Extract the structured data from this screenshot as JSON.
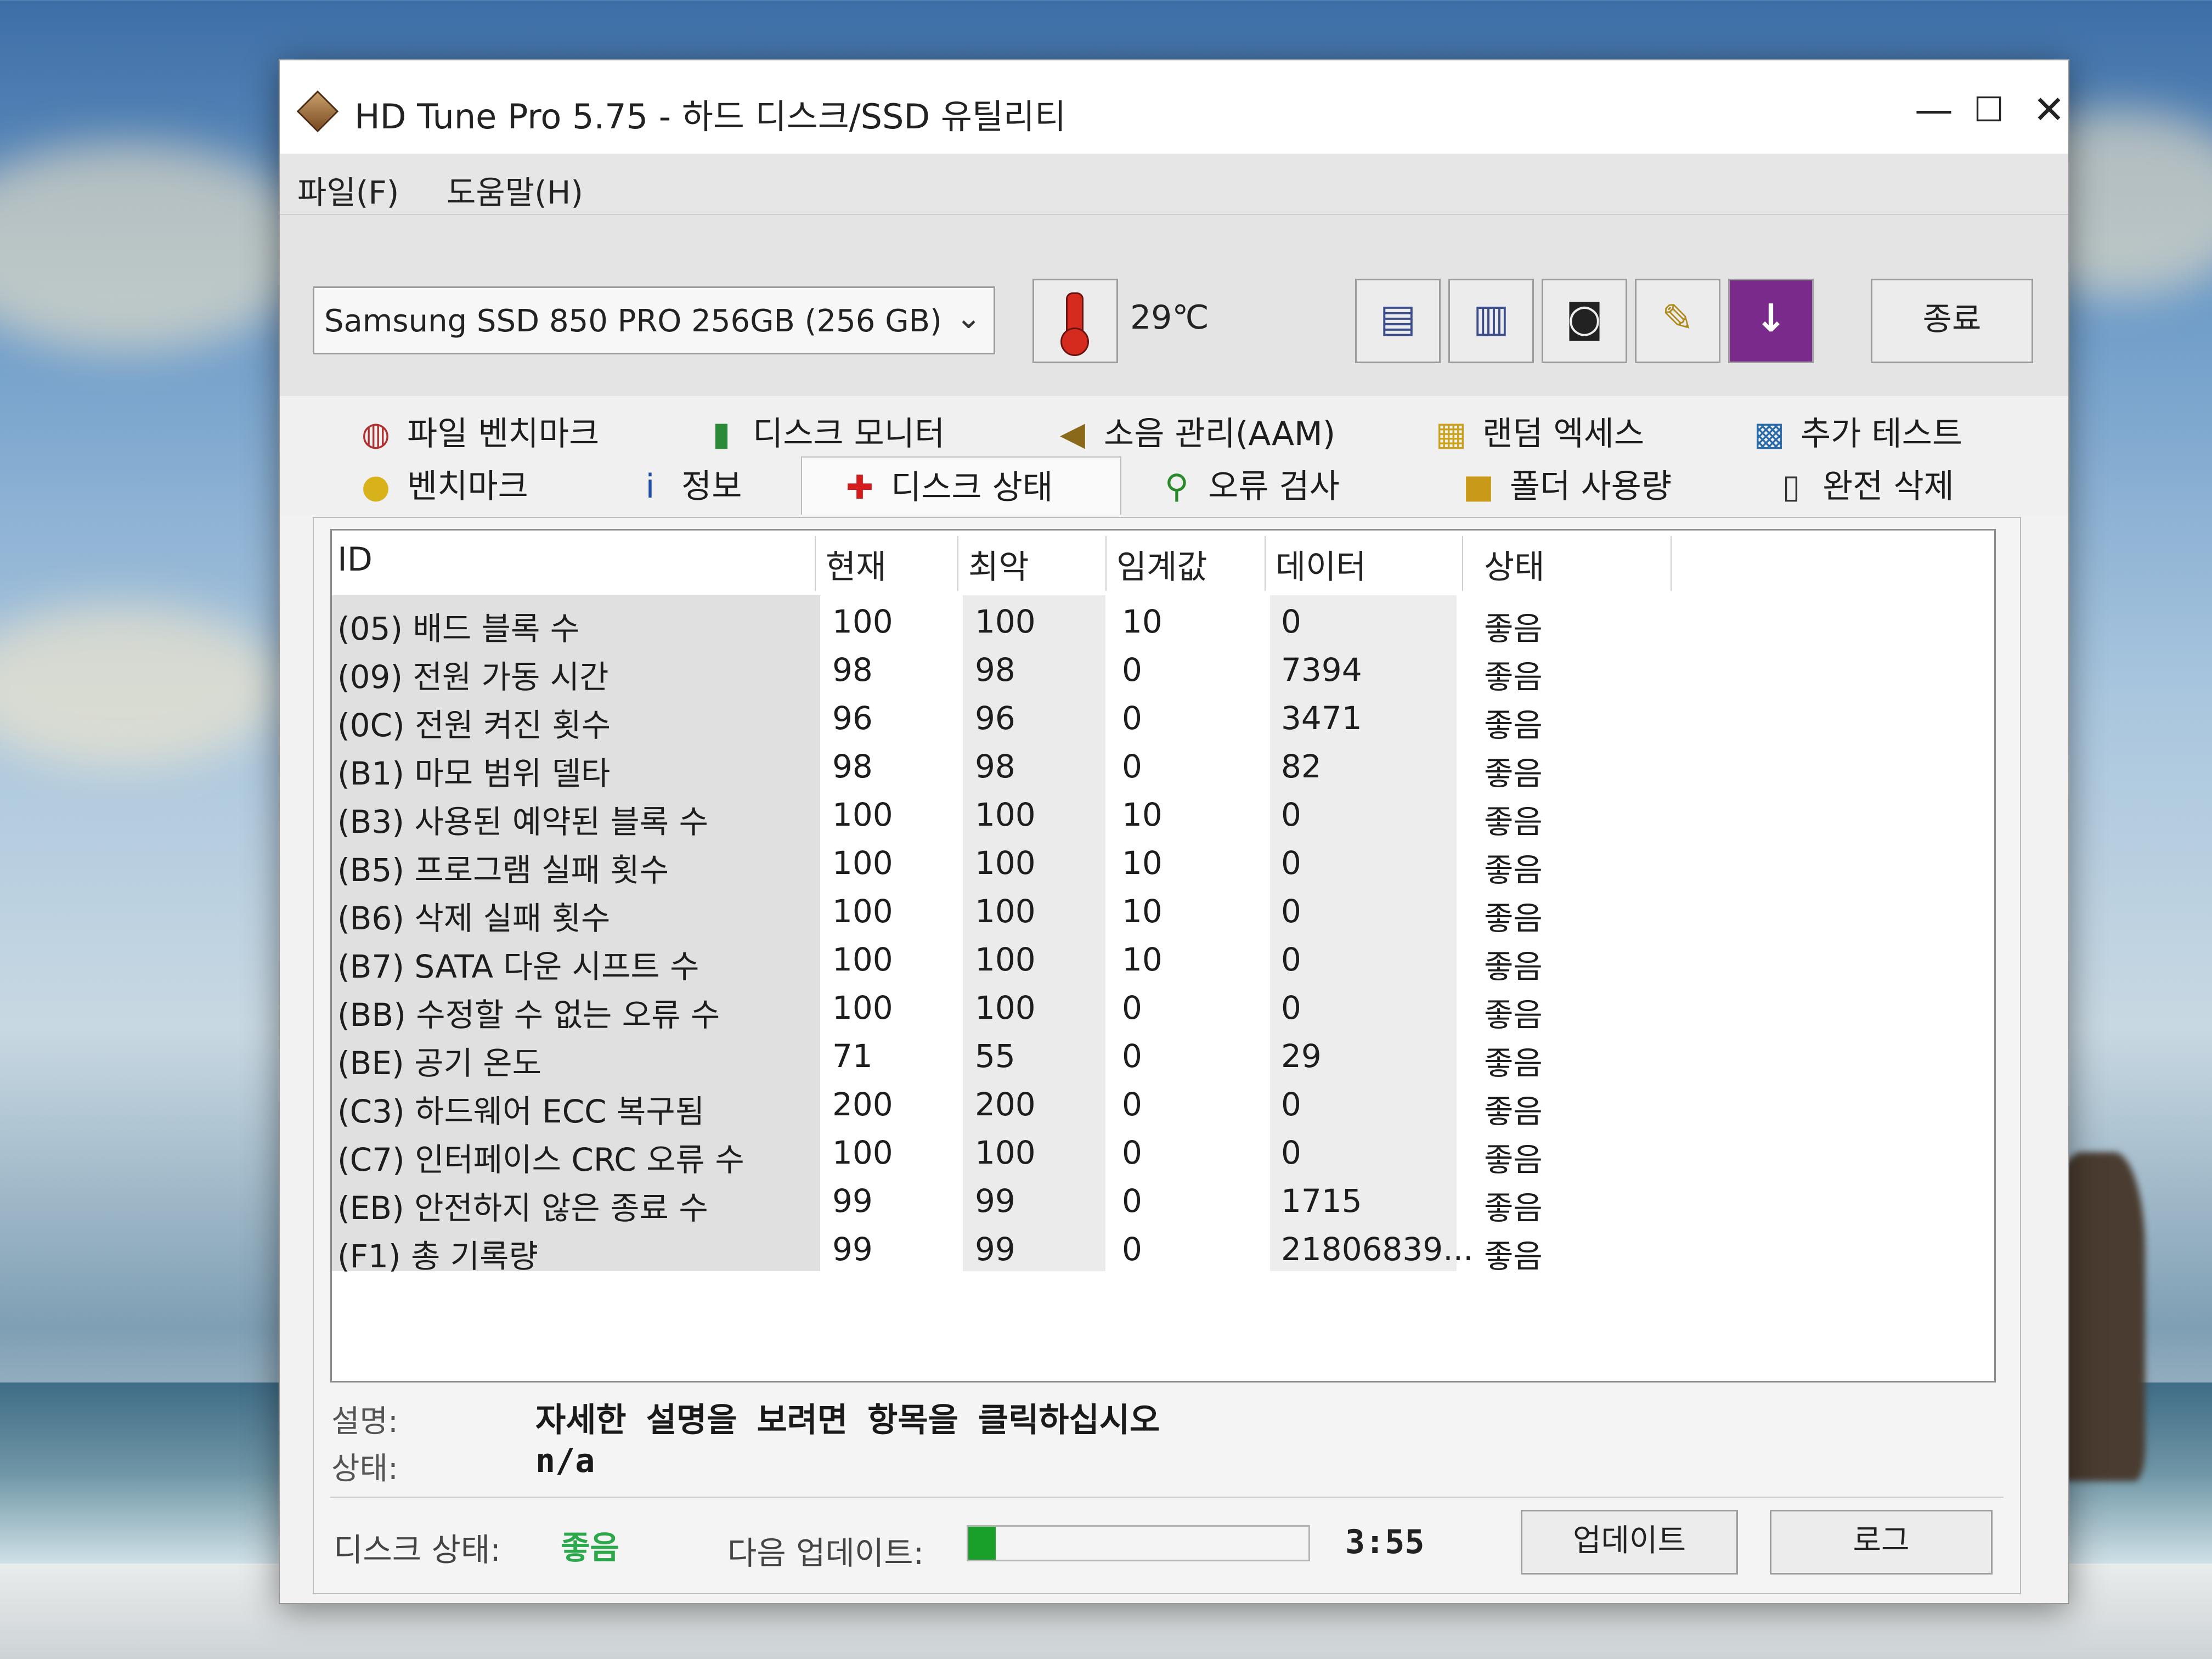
{
  "window": {
    "title": "HD Tune Pro 5.75 - 하드 디스크/SSD 유틸리티",
    "minimize": "—",
    "maximize": "☐",
    "close": "✕"
  },
  "menu": {
    "file": "파일(F)",
    "help": "도움말(H)"
  },
  "toolbar": {
    "drive": "Samsung SSD 850 PRO 256GB (256 GB)",
    "temperature": "29℃",
    "icons": [
      "copy-text-icon",
      "copy-screen-icon",
      "screenshot-icon",
      "options-icon",
      "save-down-icon"
    ],
    "exit_label": "종료"
  },
  "tabs": {
    "row1": [
      {
        "label": "파일 벤치마크",
        "icon": "file-benchmark-icon"
      },
      {
        "label": "디스크 모니터",
        "icon": "disk-monitor-icon"
      },
      {
        "label": "소음 관리(AAM)",
        "icon": "speaker-icon"
      },
      {
        "label": "랜덤 엑세스",
        "icon": "random-access-icon"
      },
      {
        "label": "추가 테스트",
        "icon": "extra-tests-icon"
      }
    ],
    "row2": [
      {
        "label": "벤치마크",
        "icon": "lightbulb-icon"
      },
      {
        "label": "정보",
        "icon": "info-icon"
      },
      {
        "label": "디스크 상태",
        "icon": "health-cross-icon"
      },
      {
        "label": "오류 검사",
        "icon": "magnifier-icon"
      },
      {
        "label": "폴더 사용량",
        "icon": "folder-icon"
      },
      {
        "label": "완전 삭제",
        "icon": "trash-icon"
      }
    ],
    "active": "디스크 상태"
  },
  "table": {
    "columns": [
      "ID",
      "현재",
      "최악",
      "임계값",
      "데이터",
      "상태"
    ],
    "rows": [
      {
        "id": "(05) 배드 블록 수",
        "current": "100",
        "worst": "100",
        "threshold": "10",
        "data": "0",
        "status": "좋음"
      },
      {
        "id": "(09) 전원 가동 시간",
        "current": "98",
        "worst": "98",
        "threshold": "0",
        "data": "7394",
        "status": "좋음"
      },
      {
        "id": "(0C) 전원 켜진 횟수",
        "current": "96",
        "worst": "96",
        "threshold": "0",
        "data": "3471",
        "status": "좋음"
      },
      {
        "id": "(B1) 마모 범위 델타",
        "current": "98",
        "worst": "98",
        "threshold": "0",
        "data": "82",
        "status": "좋음"
      },
      {
        "id": "(B3) 사용된 예약된 블록 수",
        "current": "100",
        "worst": "100",
        "threshold": "10",
        "data": "0",
        "status": "좋음"
      },
      {
        "id": "(B5) 프로그램 실패 횟수",
        "current": "100",
        "worst": "100",
        "threshold": "10",
        "data": "0",
        "status": "좋음"
      },
      {
        "id": "(B6) 삭제 실패 횟수",
        "current": "100",
        "worst": "100",
        "threshold": "10",
        "data": "0",
        "status": "좋음"
      },
      {
        "id": "(B7) SATA 다운 시프트 수",
        "current": "100",
        "worst": "100",
        "threshold": "10",
        "data": "0",
        "status": "좋음"
      },
      {
        "id": "(BB) 수정할 수 없는 오류 수",
        "current": "100",
        "worst": "100",
        "threshold": "0",
        "data": "0",
        "status": "좋음"
      },
      {
        "id": "(BE) 공기 온도",
        "current": "71",
        "worst": "55",
        "threshold": "0",
        "data": "29",
        "status": "좋음"
      },
      {
        "id": "(C3) 하드웨어 ECC 복구됨",
        "current": "200",
        "worst": "200",
        "threshold": "0",
        "data": "0",
        "status": "좋음"
      },
      {
        "id": "(C7) 인터페이스 CRC 오류 수",
        "current": "100",
        "worst": "100",
        "threshold": "0",
        "data": "0",
        "status": "좋음"
      },
      {
        "id": "(EB) 안전하지 않은 종료 수",
        "current": "99",
        "worst": "99",
        "threshold": "0",
        "data": "1715",
        "status": "좋음"
      },
      {
        "id": "(F1) 총 기록량",
        "current": "99",
        "worst": "99",
        "threshold": "0",
        "data": "21806839...",
        "status": "좋음"
      }
    ]
  },
  "details": {
    "desc_label": "설명:",
    "desc_value": "자세한 설명을 보려면 항목을 클릭하십시오",
    "state_label": "상태:",
    "state_value": "n/a"
  },
  "footer": {
    "disk_status_label": "디스크 상태:",
    "disk_status_value": "좋음",
    "next_update_label": "다음 업데이트:",
    "progress_fraction": 0.08,
    "countdown": "3:55",
    "update_button": "업데이트",
    "log_button": "로그"
  },
  "colors": {
    "status_good": "#2aa84a",
    "progress_fill": "#18a02a",
    "save_button": "#7a2a8a"
  }
}
